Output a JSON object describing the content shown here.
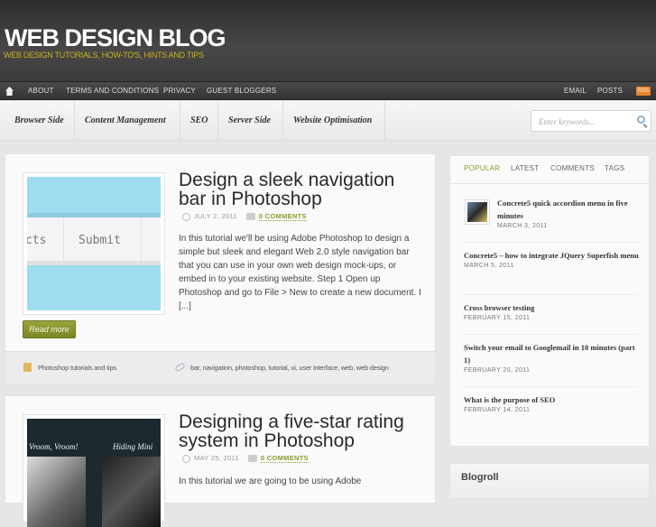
{
  "site": {
    "title": "WEB DESIGN BLOG",
    "tagline": "WEB DESIGN TUTORIALS, HOW-TO'S, HINTS AND TIPS"
  },
  "topnav": {
    "items": [
      "ABOUT",
      "TERMS AND CONDITIONS",
      "PRIVACY",
      "GUEST BLOGGERS"
    ],
    "right": [
      "EMAIL",
      "POSTS"
    ],
    "rss": "RSS"
  },
  "categories": [
    "Browser Side",
    "Content Management",
    "SEO",
    "Server Side",
    "Website Optimisation"
  ],
  "search": {
    "placeholder": "Enter keywords..."
  },
  "posts": [
    {
      "title": "Design a sleek navigation bar in Photoshop",
      "date": "JULY 2, 2011",
      "comments": "0 COMMENTS",
      "excerpt": "In this tutorial we'll be using Adobe Photoshop to design a simple but sleek and elegant Web 2.0 style navigation bar that you can use in your own web design mock-ups, or embed in to your existing website. Step 1 Open up Photoshop and go to File > New to create a new document. I [...]",
      "thumb_text": [
        "cts",
        "Submit"
      ],
      "read_more": "Read more",
      "category": "Photoshop tutorials and tips",
      "tags": "bar, navigation, photoshop, tutorial, ui, user interface, web, web design"
    },
    {
      "title": "Designing a five-star rating system in Photoshop",
      "date": "MAY 25, 2011",
      "comments": "0 COMMENTS",
      "excerpt": "In this tutorial we are going to be using Adobe",
      "thumb_text": [
        "Vroom, Vroom!",
        "Hiding Mini"
      ]
    }
  ],
  "sidebar": {
    "tabs": [
      "POPULAR",
      "LATEST",
      "COMMENTS",
      "TAGS"
    ],
    "items": [
      {
        "title": "Concrete5 quick accordion menu in five minutes",
        "date": "MARCH 3, 2011"
      },
      {
        "title": "Concrete5 – how to integrate JQuery Superfish menu",
        "date": "MARCH 5, 2011"
      },
      {
        "title": "Cross browser testing",
        "date": "FEBRUARY 15, 2011"
      },
      {
        "title": "Switch your email to Googlemail in 10 minutes (part 1)",
        "date": "FEBRUARY 20, 2011"
      },
      {
        "title": "What is the purpose of SEO",
        "date": "FEBRUARY 14, 2011"
      }
    ]
  },
  "blogroll": {
    "title": "Blogroll"
  },
  "colors": {
    "accent": "#8c9c2a",
    "tagline": "#c9b21c"
  }
}
